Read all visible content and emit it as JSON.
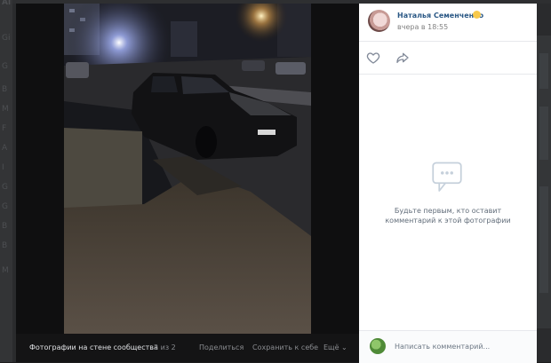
{
  "page": {
    "nav_stub_chars": [
      "Al",
      "Gi",
      "G",
      "B",
      "M",
      "F",
      "A",
      "I",
      "G",
      "G",
      "B",
      "B",
      "M"
    ]
  },
  "viewer": {
    "footer": {
      "album_title": "Фотографии на стене сообщества",
      "counter": "2 из 2",
      "share_label": "Поделиться",
      "save_label": "Сохранить к себе",
      "more_label": "Ещё ⌄"
    }
  },
  "side_panel": {
    "author_name": "Наталья Семенченко",
    "post_time": "вчера в 18:55",
    "empty_comments_text": "Будьте первым, кто оставит комментарий к этой фотографии",
    "comment_placeholder": "Написать комментарий...",
    "icons": {
      "like": "heart-icon",
      "share": "share-arrow-icon",
      "empty": "chat-bubble-icon"
    }
  },
  "colors": {
    "link": "#2a5885",
    "muted": "#828282",
    "viewer_bg": "#141415"
  }
}
